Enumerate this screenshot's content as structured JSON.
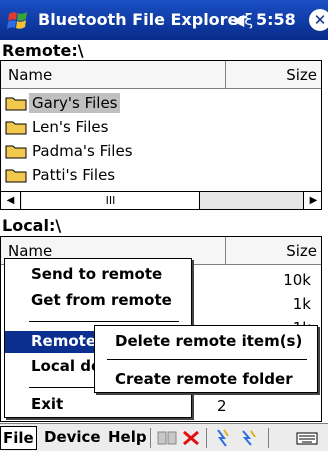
{
  "titlebar": {
    "title": "Bluetooth File Explorer",
    "speaker_glyph": "◀ξ",
    "time": "5:58",
    "close_label": "✕",
    "logo_icon": "windows-flag-icon"
  },
  "remote": {
    "label": "Remote:\\",
    "columns": {
      "name": "Name",
      "size": "Size"
    },
    "items": [
      {
        "name": "Gary's Files",
        "selected": true
      },
      {
        "name": "Len's Files",
        "selected": false
      },
      {
        "name": "Padma's Files",
        "selected": false
      },
      {
        "name": "Patti's Files",
        "selected": false
      }
    ],
    "scroll_thumb": "III"
  },
  "local": {
    "label": "Local:\\",
    "columns": {
      "name": "Name",
      "size": "Size"
    },
    "sizes": [
      "10k",
      "1k",
      "1k",
      "2"
    ]
  },
  "file_menu": {
    "items": [
      "Send to remote",
      "Get from remote",
      "Remote",
      "Local de",
      "Exit"
    ],
    "highlighted": "Remote"
  },
  "remote_submenu": {
    "items": [
      "Delete remote item(s)",
      "Create remote folder"
    ]
  },
  "menubar": {
    "file": "File",
    "device": "Device",
    "help": "Help",
    "tools": [
      "connect-icon",
      "disconnect-icon",
      "refresh-icon",
      "bluetooth-icon",
      "keyboard-icon"
    ]
  },
  "colors": {
    "titlebar": "#0a2f8f",
    "highlight": "#0a2f8f",
    "folder": "#f2c94c"
  }
}
